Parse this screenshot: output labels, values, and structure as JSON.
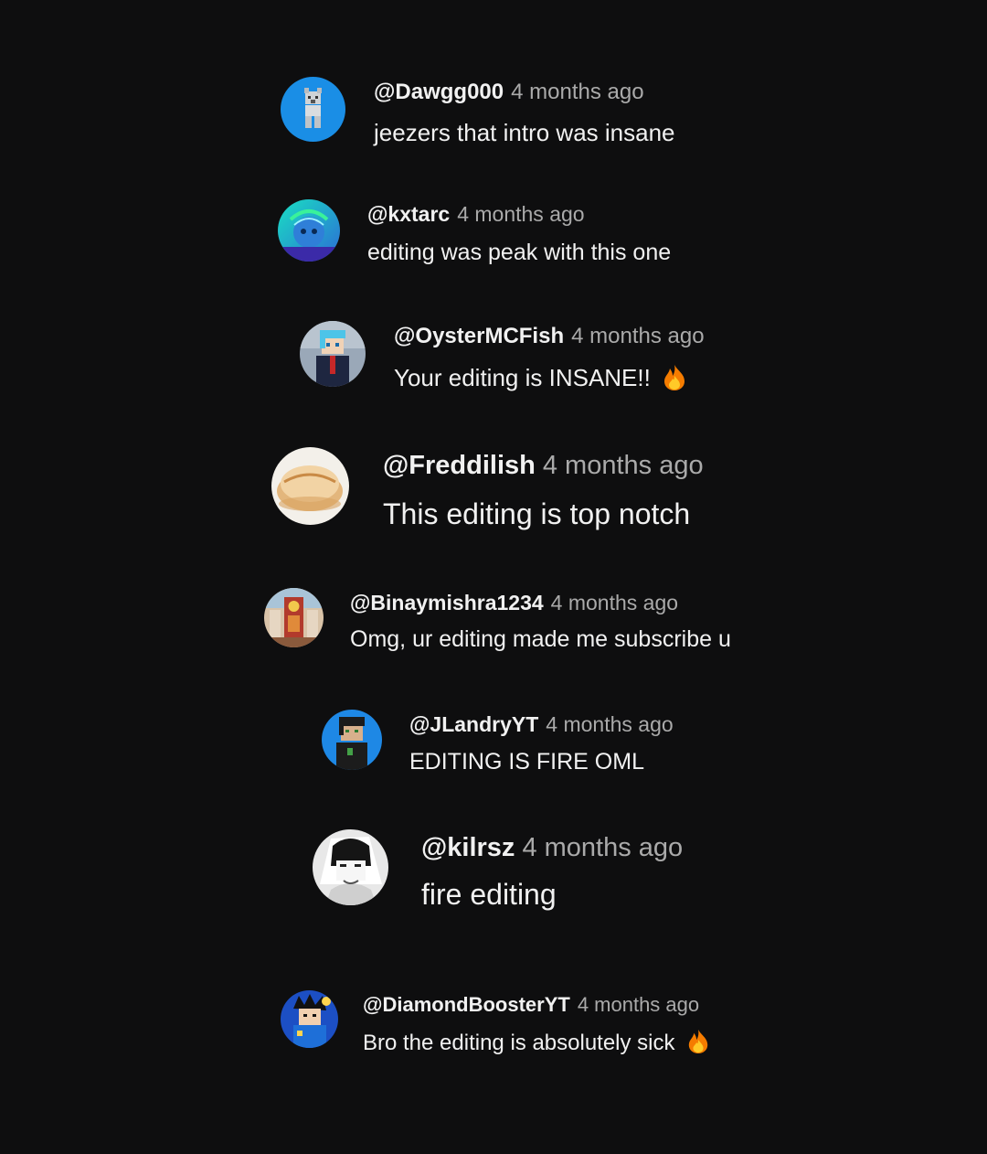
{
  "comments": [
    {
      "handle": "@Dawgg000",
      "time": "4 months ago",
      "text": "jeezers that intro was insane",
      "avatar_icon": "minecraft-wolf-avatar",
      "avatar_color": "#1a8ee6"
    },
    {
      "handle": "@kxtarc",
      "time": "4 months ago",
      "text": "editing was peak with this one",
      "avatar_icon": "cartoon-character-avatar",
      "avatar_color": "#1fb7c4"
    },
    {
      "handle": "@OysterMCFish",
      "time": "4 months ago",
      "text": "Your editing is INSANE!!",
      "emoji_icon": "fire-icon",
      "avatar_icon": "minecraft-suit-avatar",
      "avatar_color": "#9aa8b8"
    },
    {
      "handle": "@Freddilish",
      "time": "4 months ago",
      "text": "This editing is top notch",
      "avatar_icon": "bread-avatar",
      "avatar_color": "#e9c89a"
    },
    {
      "handle": "@Binaymishra1234",
      "time": "4 months ago",
      "text": "Omg, ur editing made me subscribe u",
      "avatar_icon": "shrine-avatar",
      "avatar_color": "#c9a07a"
    },
    {
      "handle": "@JLandryYT",
      "time": "4 months ago",
      "text": "EDITING IS FIRE OML",
      "avatar_icon": "minecraft-character-avatar",
      "avatar_color": "#1e88e5"
    },
    {
      "handle": "@kilrsz",
      "time": "4 months ago",
      "text": "fire editing",
      "avatar_icon": "manga-character-avatar",
      "avatar_color": "#e8e8e8"
    },
    {
      "handle": "@DiamondBoosterYT",
      "time": "4 months ago",
      "text": "Bro the editing is absolutely sick",
      "emoji_icon": "fire-icon",
      "avatar_icon": "anime-character-avatar",
      "avatar_color": "#1c4fc4"
    }
  ]
}
